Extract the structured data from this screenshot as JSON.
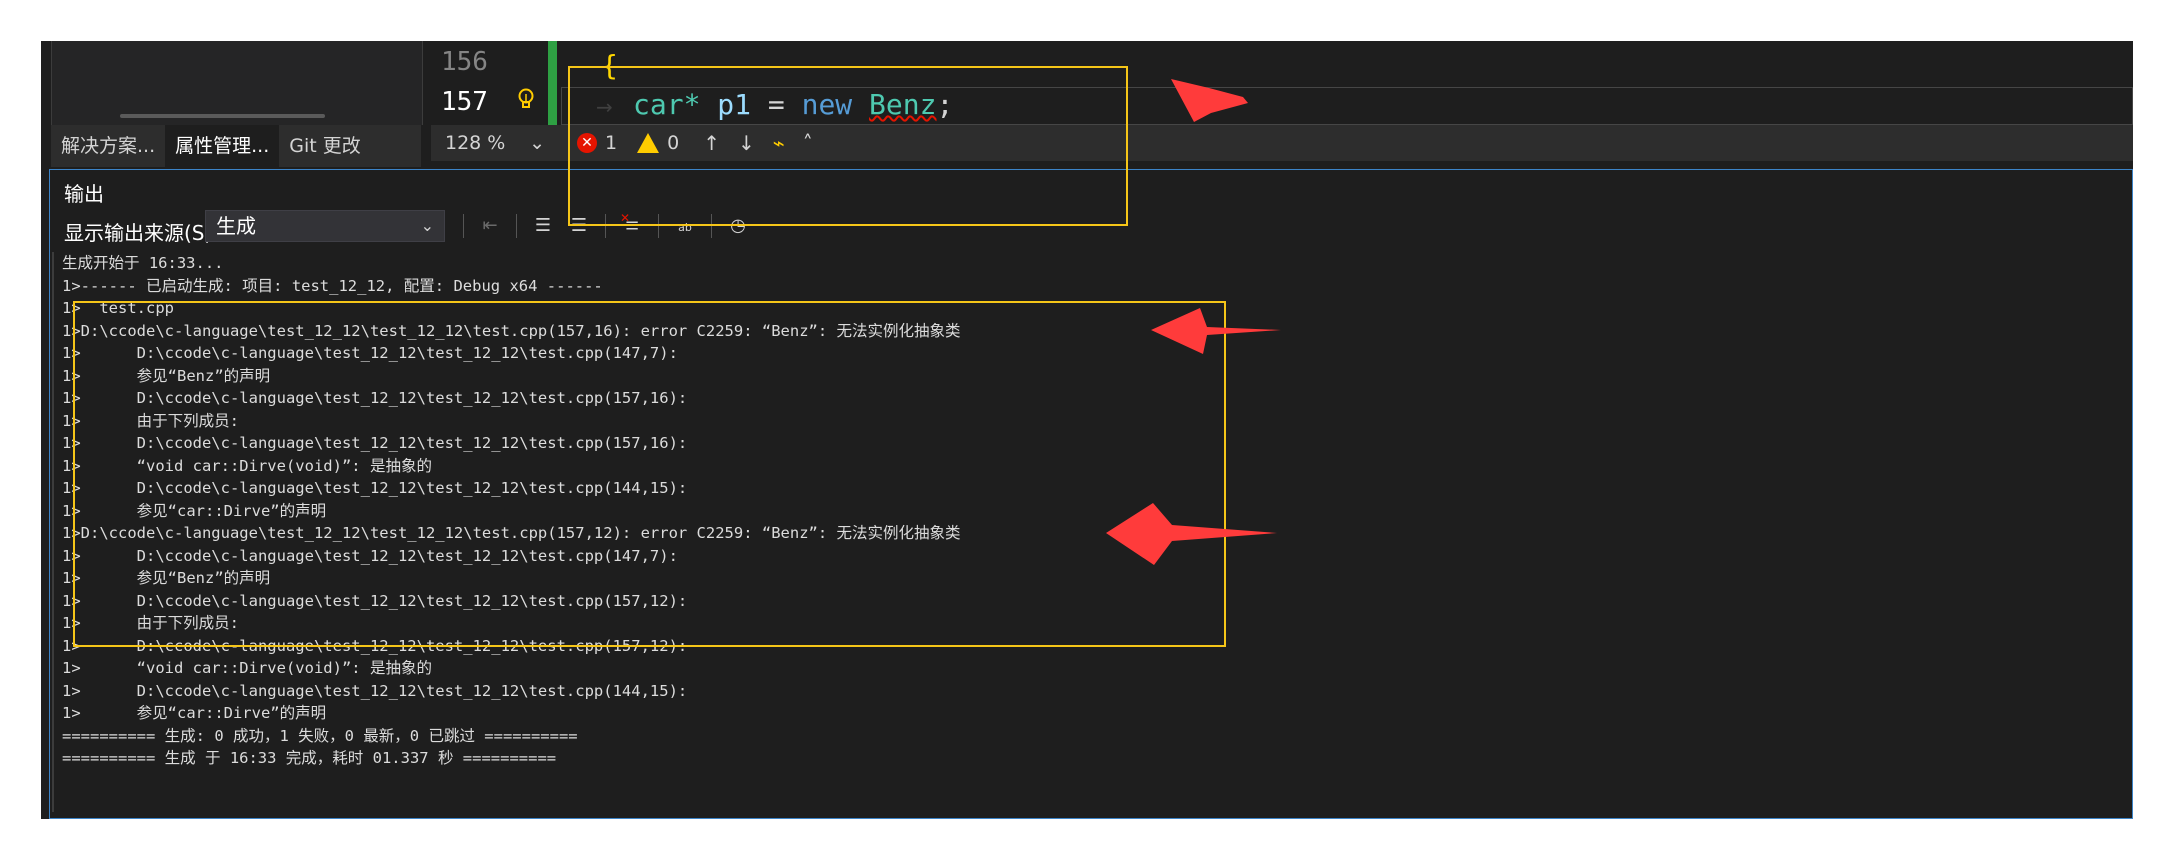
{
  "left_panel": {
    "tabs": [
      "解决方案...",
      "属性管理...",
      "Git 更改"
    ],
    "active_tab": 1
  },
  "editor": {
    "line_numbers": [
      "156",
      "157"
    ],
    "brace": "{",
    "code_tokens": {
      "type": "car*",
      "var": "p1",
      "assign": "=",
      "kw": "new",
      "class": "Benz",
      "end": ";"
    },
    "indent_glyph": "→"
  },
  "editor_status": {
    "zoom": "128 %",
    "errors": "1",
    "warnings": "0"
  },
  "output": {
    "title": "输出",
    "source_label": "显示输出来源(S):",
    "source_value": "生成",
    "lines": [
      "生成开始于 16:33...",
      "1>------ 已启动生成: 项目: test_12_12, 配置: Debug x64 ------",
      "1>  test.cpp",
      "1>D:\\ccode\\c-language\\test_12_12\\test_12_12\\test.cpp(157,16): error C2259: “Benz”: 无法实例化抽象类",
      "1>      D:\\ccode\\c-language\\test_12_12\\test_12_12\\test.cpp(147,7):",
      "1>      参见“Benz”的声明",
      "1>      D:\\ccode\\c-language\\test_12_12\\test_12_12\\test.cpp(157,16):",
      "1>      由于下列成员:",
      "1>      D:\\ccode\\c-language\\test_12_12\\test_12_12\\test.cpp(157,16):",
      "1>      “void car::Dirve(void)”: 是抽象的",
      "1>      D:\\ccode\\c-language\\test_12_12\\test_12_12\\test.cpp(144,15):",
      "1>      参见“car::Dirve”的声明",
      "1>D:\\ccode\\c-language\\test_12_12\\test_12_12\\test.cpp(157,12): error C2259: “Benz”: 无法实例化抽象类",
      "1>      D:\\ccode\\c-language\\test_12_12\\test_12_12\\test.cpp(147,7):",
      "1>      参见“Benz”的声明",
      "1>      D:\\ccode\\c-language\\test_12_12\\test_12_12\\test.cpp(157,12):",
      "1>      由于下列成员:",
      "1>      D:\\ccode\\c-language\\test_12_12\\test_12_12\\test.cpp(157,12):",
      "1>      “void car::Dirve(void)”: 是抽象的",
      "1>      D:\\ccode\\c-language\\test_12_12\\test_12_12\\test.cpp(144,15):",
      "1>      参见“car::Dirve”的声明",
      "========== 生成: 0 成功，1 失败，0 最新，0 已跳过 ==========",
      "========== 生成 于 16:33 完成，耗时 01.337 秒 =========="
    ]
  },
  "colors": {
    "annotation_box": "#f5c518",
    "annotation_arrow": "#ff3b3b",
    "error_red": "#e51400",
    "warning_yellow": "#ffcc00"
  }
}
